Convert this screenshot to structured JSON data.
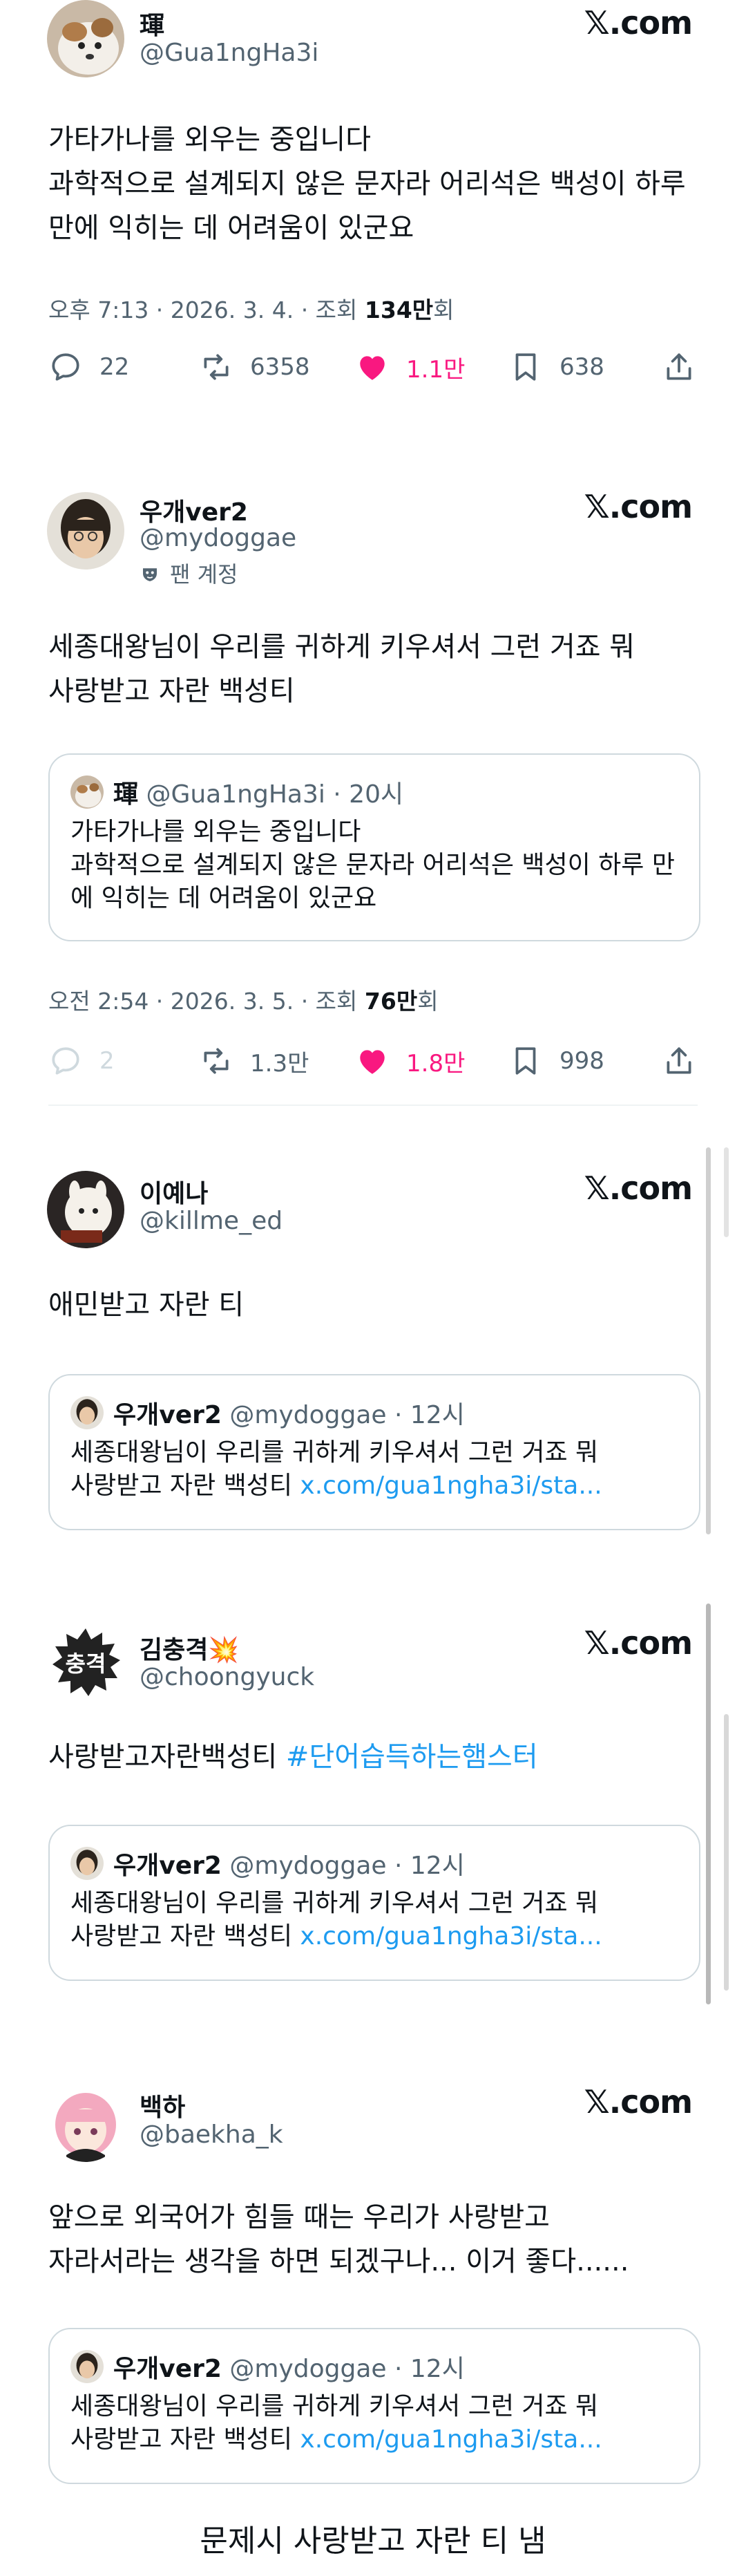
{
  "brand": {
    "x_logo": "𝕏",
    "x_domain": ".com",
    "like_color": "#f91880",
    "link_color": "#1d9bf0"
  },
  "post1": {
    "name": "琿",
    "handle": "@Gua1ngHa3i",
    "text": "가타가나를 외우는 중입니다\n과학적으로 설계되지 않은 문자라 어리석은 백성이 하루\n만에 익히는 데 어려움이 있군요",
    "meta_prefix": "오후 7:13 · 2026. 3. 4. · 조회 ",
    "meta_views": "134만",
    "meta_suffix": "회",
    "replies": "22",
    "reposts": "6358",
    "likes": "1.1만",
    "bookmarks": "638"
  },
  "post2": {
    "name": "우개ver2",
    "handle": "@mydoggae",
    "fan_label": "팬 계정",
    "text": "세종대왕님이 우리를 귀하게 키우셔서 그런 거죠 뭐\n사랑받고 자란 백성티",
    "quote": {
      "name": "琿",
      "handle": "@Gua1ngHa3i · 20시",
      "text": "가타가나를 외우는 중입니다\n과학적으로 설계되지 않은 문자라 어리석은 백성이 하루 만\n에 익히는 데 어려움이 있군요"
    },
    "meta_prefix": "오전 2:54 · 2026. 3. 5. · 조회 ",
    "meta_views": "76만",
    "meta_suffix": "회",
    "replies": "2",
    "reposts": "1.3만",
    "likes": "1.8만",
    "bookmarks": "998"
  },
  "post3": {
    "name": "이예나",
    "handle": "@killme_ed",
    "text": "애민받고 자란 티",
    "quote": {
      "name": "우개ver2",
      "handle": "@mydoggae · 12시",
      "line1": "세종대왕님이 우리를 귀하게 키우셔서 그런 거죠 뭐",
      "line2_text": "사랑받고 자란 백성티 ",
      "line2_link": "x.com/gua1ngha3i/sta..."
    }
  },
  "post4": {
    "name": "김충격",
    "name_emoji": "💥",
    "handle": "@choongyuck",
    "avatar_text": "충격",
    "text": "사랑받고자란백성티 ",
    "hashtag": "#단어습득하는햄스터",
    "quote": {
      "name": "우개ver2",
      "handle": "@mydoggae · 12시",
      "line1": "세종대왕님이 우리를 귀하게 키우셔서 그런 거죠 뭐",
      "line2_text": "사랑받고 자란 백성티 ",
      "line2_link": "x.com/gua1ngha3i/sta..."
    }
  },
  "post5": {
    "name": "백하",
    "handle": "@baekha_k",
    "text": "앞으로 외국어가 힘들 때는 우리가 사랑받고\n자라서라는 생각을 하면 되겠구나... 이거 좋다......",
    "quote": {
      "name": "우개ver2",
      "handle": "@mydoggae · 12시",
      "line1": "세종대왕님이 우리를 귀하게 키우셔서 그런 거죠 뭐",
      "line2_text": "사랑받고 자란 백성티 ",
      "line2_link": "x.com/gua1ngha3i/sta..."
    }
  },
  "caption": "문제시 사랑받고 자란 티 냄"
}
